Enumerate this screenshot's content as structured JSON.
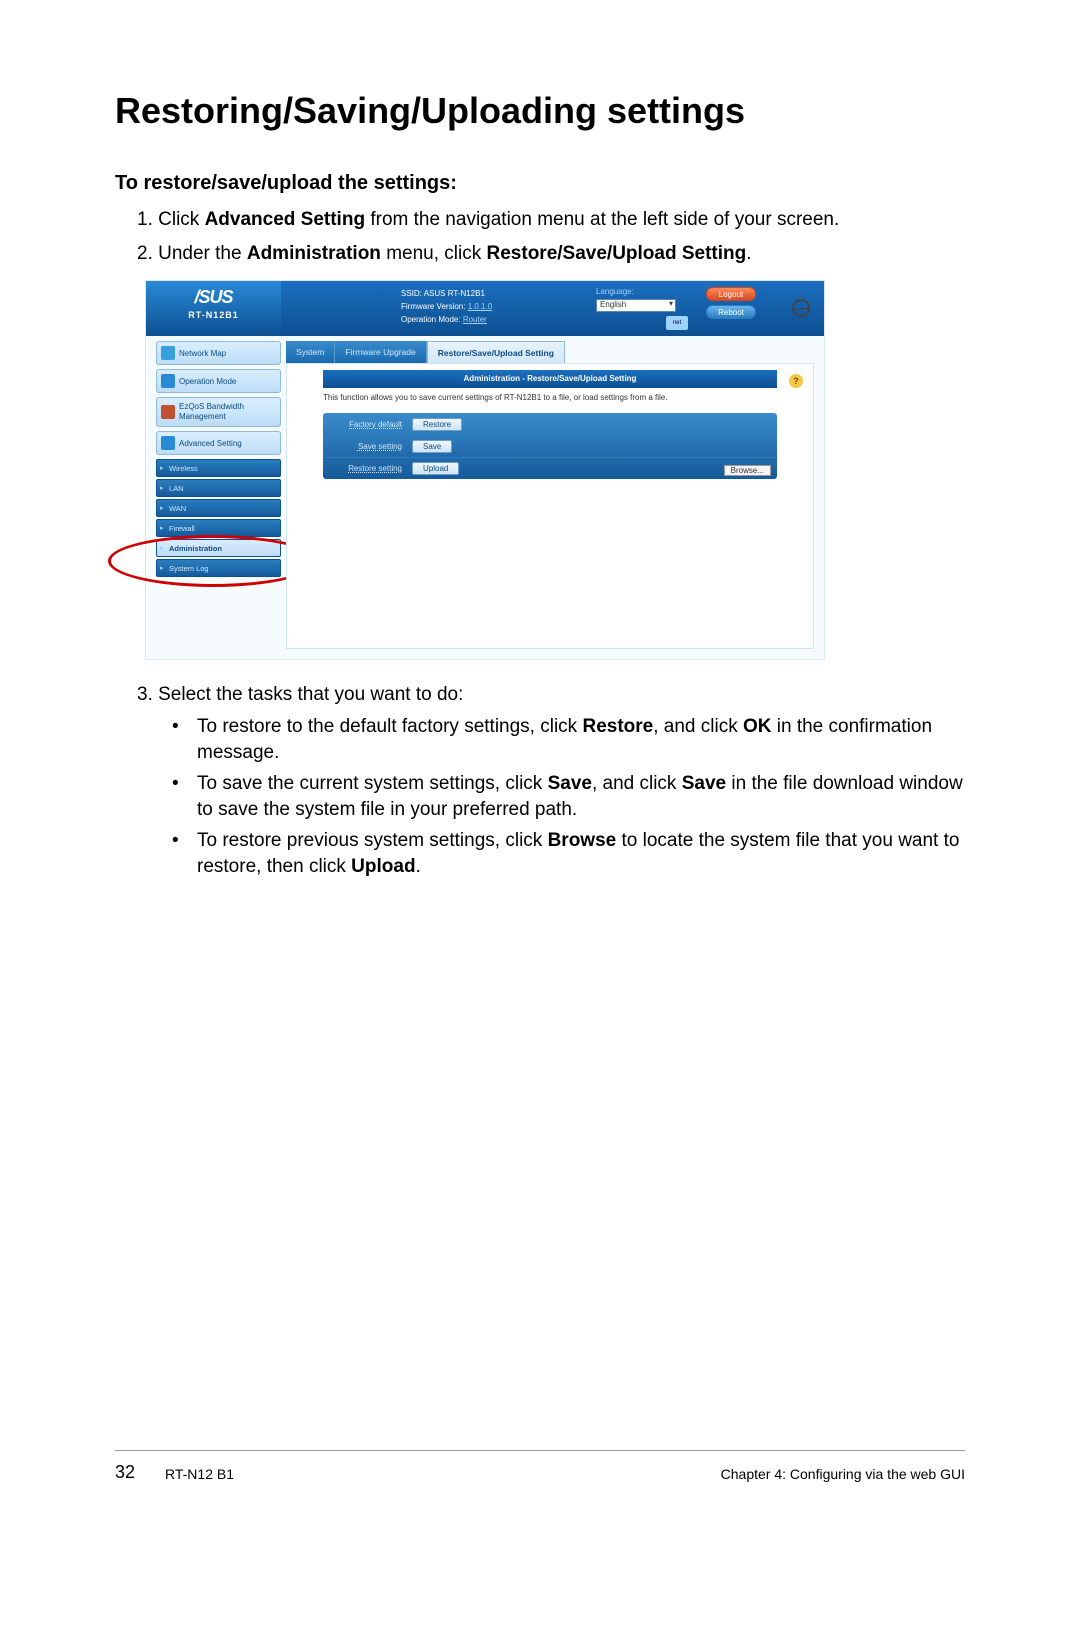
{
  "title": "Restoring/Saving/Uploading settings",
  "subhead": "To restore/save/upload the settings:",
  "steps": {
    "s1_num": "1.  ",
    "s1_a": "Click ",
    "s1_b": "Advanced Setting",
    "s1_c": " from the navigation menu at the left side of your screen.",
    "s2_num": "2.  ",
    "s2_a": "Under the ",
    "s2_b": "Administration",
    "s2_c": " menu, click ",
    "s2_d": "Restore/Save/Upload Setting",
    "s2_e": ".",
    "s3_num": "3.  ",
    "s3_a": "Select the tasks that you want to do:"
  },
  "bul": {
    "b1_a": "To restore to the default factory settings, click ",
    "b1_b": "Restore",
    "b1_c": ", and click ",
    "b1_d": "OK",
    "b1_e": " in the confirmation message.",
    "b2_a": "To save the current system settings, click ",
    "b2_b": "Save",
    "b2_c": ", and click ",
    "b2_d": "Save",
    "b2_e": " in the file download window to save the system file in your preferred path.",
    "b3_a": "To restore previous system settings, click ",
    "b3_b": "Browse",
    "b3_c": " to locate the system file that you want to restore, then click ",
    "b3_d": "Upload",
    "b3_e": "."
  },
  "router": {
    "logo_brand": "/SUS",
    "logo_model": "RT-N12B1",
    "ssid_label": "SSID:",
    "ssid_value": "ASUS RT-N12B1",
    "fw_label": "Firmware Version:",
    "fw_value": "1.0.1.0",
    "mode_label": "Operation Mode:",
    "mode_value": "Router",
    "lang_label": "Language:",
    "lang_value": "English",
    "net_icon": "net",
    "logout": "Logout",
    "reboot": "Reboot",
    "nav": {
      "netmap": "Network Map",
      "opmode": "Operation Mode",
      "ezqos": "EzQoS Bandwidth Management",
      "adv": "Advanced Setting",
      "wireless": "Wireless",
      "lan": "LAN",
      "wan": "WAN",
      "firewall": "Firewall",
      "admin": "Administration",
      "syslog": "System Log"
    },
    "tabs": {
      "system": "System",
      "fwup": "Firmware Upgrade",
      "rsu": "Restore/Save/Upload Setting"
    },
    "panel": {
      "title": "Administration - Restore/Save/Upload Setting",
      "desc": "This function allows you to save current settings of RT-N12B1 to a file, or load settings from a file.",
      "row1_lbl": "Factory default",
      "row1_btn": "Restore",
      "row2_lbl": "Save setting",
      "row2_btn": "Save",
      "row3_lbl": "Restore setting",
      "row3_btn": "Upload",
      "browse": "Browse..."
    },
    "help": "?"
  },
  "footer": {
    "page": "32",
    "model": "RT-N12 B1",
    "chapter": "Chapter 4: Configuring via the web GUI"
  }
}
